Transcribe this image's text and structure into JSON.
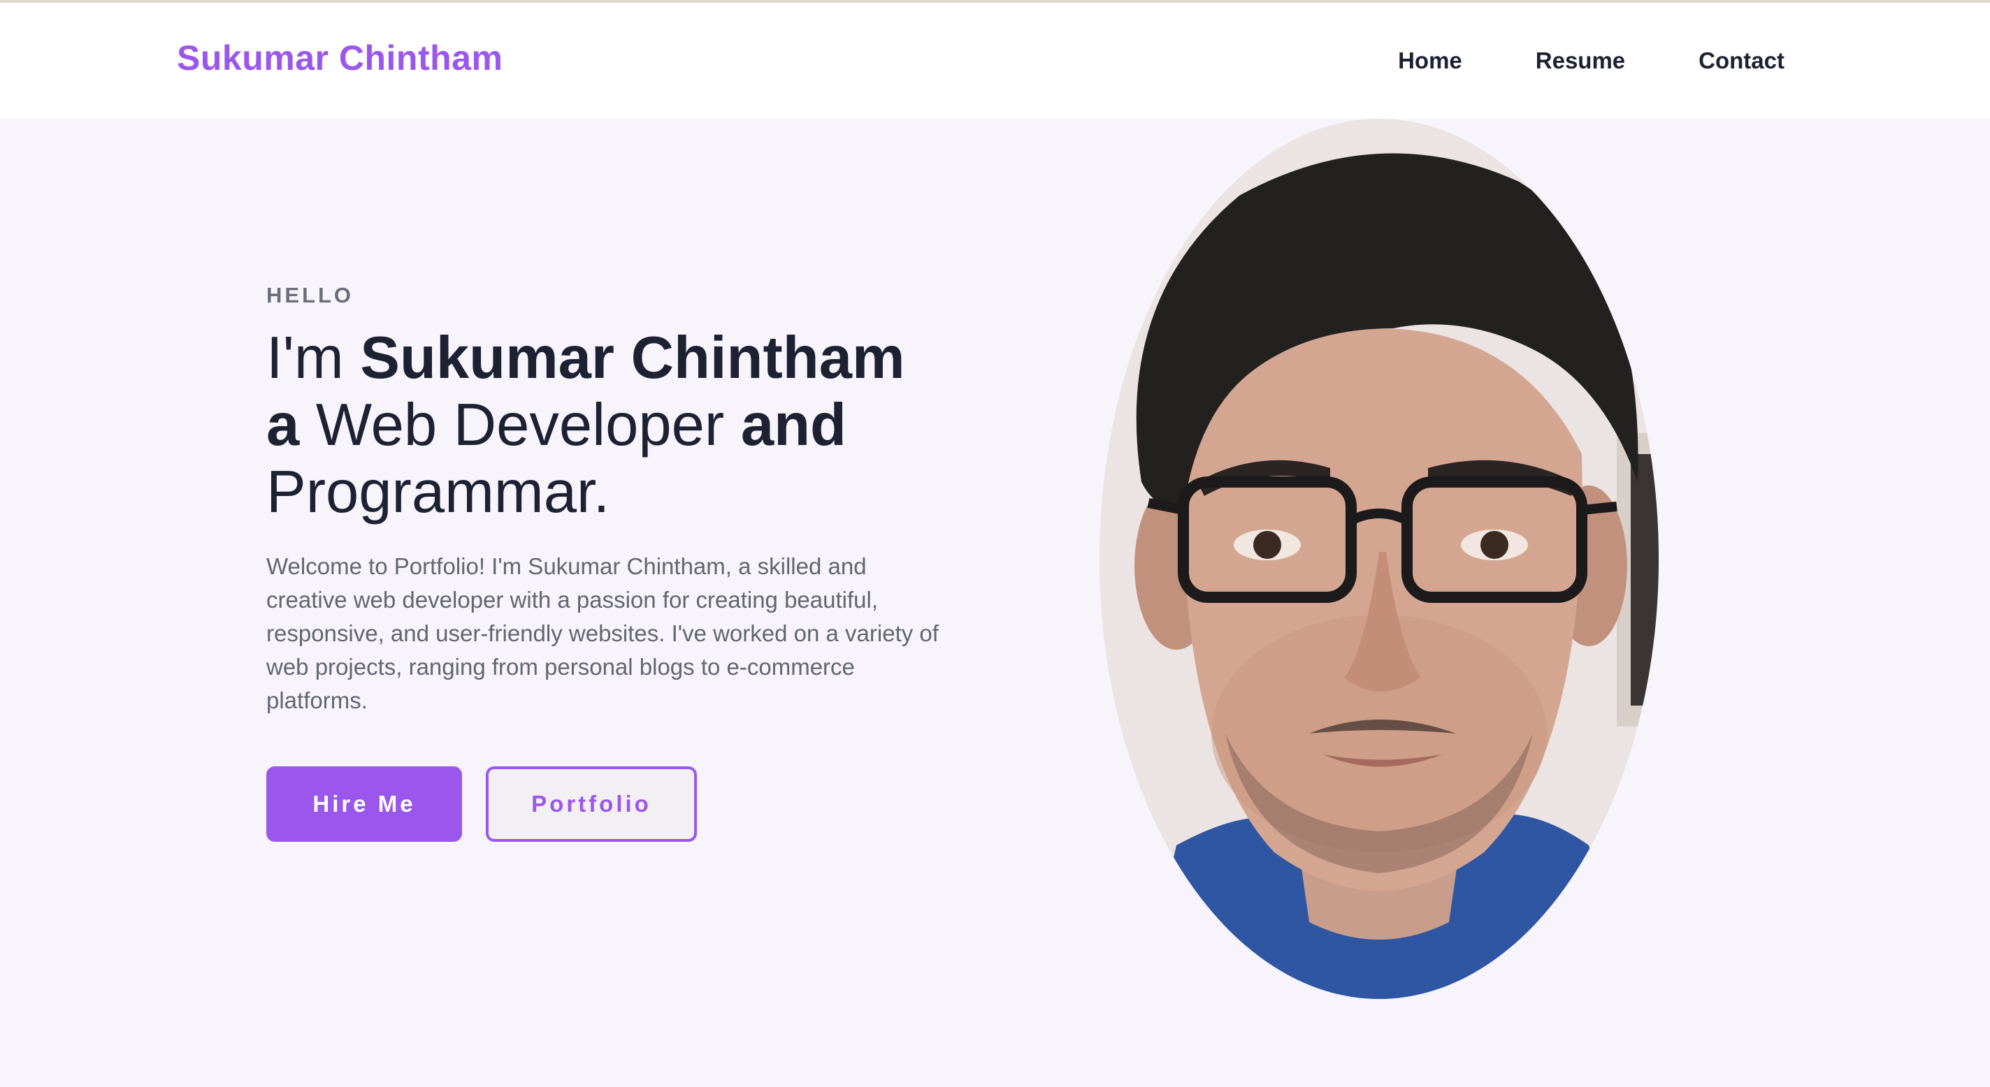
{
  "navbar": {
    "brand": "Sukumar Chintham",
    "links": [
      "Home",
      "Resume",
      "Contact"
    ]
  },
  "hero": {
    "eyebrow": "HELLO",
    "headline": {
      "im": "I'm ",
      "name": "Sukumar Chintham",
      "a": "a",
      "role": " Web Developer ",
      "and": "and",
      "role2": "Programmar."
    },
    "intro": "Welcome to Portfolio! I'm Sukumar Chintham, a skilled and creative web developer with a passion for creating beautiful, responsive, and user-friendly websites. I've worked on a variety of web projects, ranging from personal blogs to e-commerce platforms.",
    "buttons": {
      "hire": "Hire Me",
      "portfolio": "Portfolio"
    }
  },
  "colors": {
    "accent": "#9b57ec",
    "text_dark": "#1d2233",
    "text_muted": "#62666f",
    "hero_bg": "#f7f4fc"
  },
  "icons": {
    "portrait": "profile-photo"
  }
}
